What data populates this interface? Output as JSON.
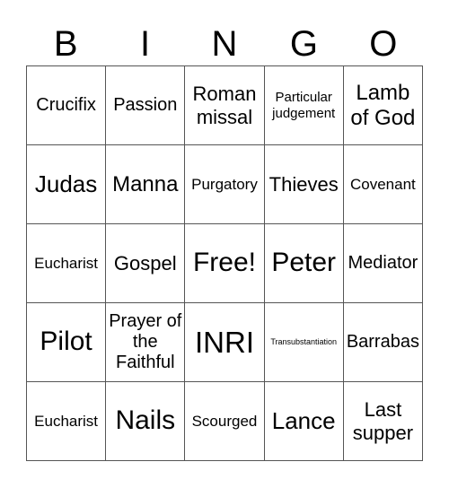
{
  "header": {
    "letters": [
      "B",
      "I",
      "N",
      "G",
      "O"
    ]
  },
  "grid": {
    "rows": [
      [
        "Crucifix",
        "Passion",
        "Roman missal",
        "Particular judgement",
        "Lamb of God"
      ],
      [
        "Judas",
        "Manna",
        "Purgatory",
        "Thieves",
        "Covenant"
      ],
      [
        "Eucharist",
        "Gospel",
        "Free!",
        "Peter",
        "Mediator"
      ],
      [
        "Pilot",
        "Prayer of the Faithful",
        "INRI",
        "Transubstantiation",
        "Barrabas"
      ],
      [
        "Eucharist",
        "Nails",
        "Scourged",
        "Lance",
        "Last supper"
      ]
    ]
  }
}
